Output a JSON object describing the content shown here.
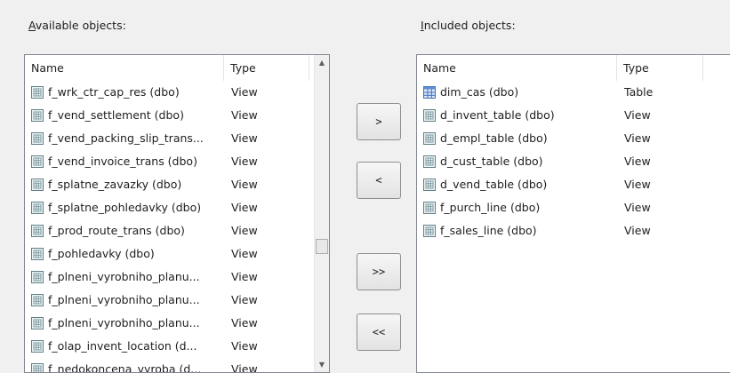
{
  "available": {
    "label": "Available objects:",
    "label_accel": "A",
    "label_rest": "vailable objects:",
    "columns": {
      "name": "Name",
      "type": "Type"
    },
    "rows": [
      {
        "name": "f_wrk_ctr_cap_res (dbo)",
        "type": "View",
        "icon": "view-icon"
      },
      {
        "name": "f_vend_settlement (dbo)",
        "type": "View",
        "icon": "view-icon"
      },
      {
        "name": "f_vend_packing_slip_trans...",
        "type": "View",
        "icon": "view-icon"
      },
      {
        "name": "f_vend_invoice_trans (dbo)",
        "type": "View",
        "icon": "view-icon"
      },
      {
        "name": "f_splatne_zavazky (dbo)",
        "type": "View",
        "icon": "view-icon"
      },
      {
        "name": "f_splatne_pohledavky (dbo)",
        "type": "View",
        "icon": "view-icon"
      },
      {
        "name": "f_prod_route_trans (dbo)",
        "type": "View",
        "icon": "view-icon"
      },
      {
        "name": "f_pohledavky (dbo)",
        "type": "View",
        "icon": "view-icon"
      },
      {
        "name": "f_plneni_vyrobniho_planu...",
        "type": "View",
        "icon": "view-icon"
      },
      {
        "name": "f_plneni_vyrobniho_planu...",
        "type": "View",
        "icon": "view-icon"
      },
      {
        "name": "f_plneni_vyrobniho_planu...",
        "type": "View",
        "icon": "view-icon"
      },
      {
        "name": "f_olap_invent_location (d...",
        "type": "View",
        "icon": "view-icon"
      },
      {
        "name": "f_nedokoncena_vyroba (d...",
        "type": "View",
        "icon": "view-icon"
      }
    ],
    "scroll_position": 0.62
  },
  "included": {
    "label": "Included objects:",
    "label_accel": "I",
    "label_rest": "ncluded objects:",
    "columns": {
      "name": "Name",
      "type": "Type"
    },
    "rows": [
      {
        "name": "dim_cas (dbo)",
        "type": "Table",
        "icon": "table-icon"
      },
      {
        "name": "d_invent_table (dbo)",
        "type": "View",
        "icon": "view-icon"
      },
      {
        "name": "d_empl_table (dbo)",
        "type": "View",
        "icon": "view-icon"
      },
      {
        "name": "d_cust_table (dbo)",
        "type": "View",
        "icon": "view-icon"
      },
      {
        "name": "d_vend_table (dbo)",
        "type": "View",
        "icon": "view-icon"
      },
      {
        "name": "f_purch_line (dbo)",
        "type": "View",
        "icon": "view-icon"
      },
      {
        "name": "f_sales_line (dbo)",
        "type": "View",
        "icon": "view-icon"
      }
    ]
  },
  "buttons": {
    "add": ">",
    "remove": "<",
    "add_all": ">>",
    "remove_all": "<<"
  }
}
